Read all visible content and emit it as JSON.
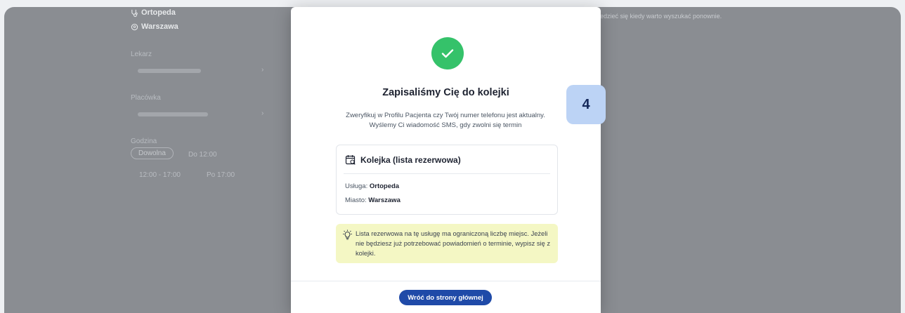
{
  "background": {
    "service": "Ortopeda",
    "city": "Warszawa",
    "doctor_label": "Lekarz",
    "facility_label": "Placówka",
    "time_label": "Godzina",
    "time_options": [
      "Dowolna",
      "Do 12:00",
      "12:00 - 17:00",
      "Po 17:00"
    ],
    "hint_text": "edzieć się kiedy warto wyszukać ponownie."
  },
  "modal": {
    "title": "Zapisaliśmy Cię do kolejki",
    "description": "Zweryfikuj w Profilu Pacjenta czy Twój numer telefonu jest aktualny. Wyślemy Ci wiadomość SMS, gdy zwolni się termin",
    "card": {
      "title": "Kolejka (lista rezerwowa)",
      "service_label": "Usługa:",
      "service_value": "Ortopeda",
      "city_label": "Miasto:",
      "city_value": "Warszawa"
    },
    "note": "Lista rezerwowa na tę usługę ma ograniczoną liczbę miejsc. Jeżeli nie będziesz już potrzebować powiadomień o terminie, wypisz się z kolejki.",
    "button_label": "Wróć do strony głównej"
  },
  "step_badge": "4",
  "colors": {
    "success": "#35c26a",
    "primary": "#1f4aa8",
    "note_bg": "#f4f7c4",
    "badge_bg": "#bcd3f5"
  },
  "icons": [
    "stethoscope-icon",
    "location-pin-icon",
    "checkmark-icon",
    "calendar-queue-icon",
    "lightbulb-icon"
  ]
}
